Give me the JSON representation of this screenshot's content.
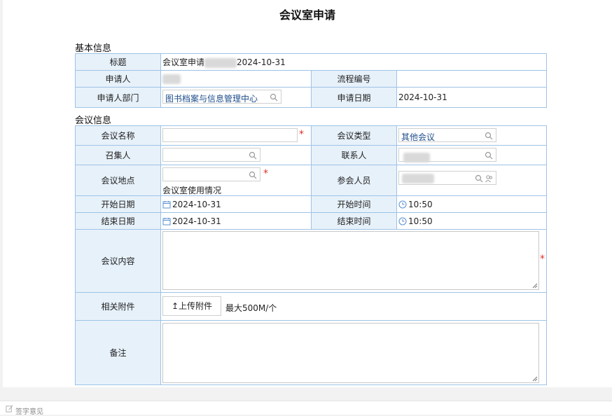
{
  "page_title": "会议室申请",
  "sections": {
    "basic": "基本信息",
    "meeting": "会议信息"
  },
  "basic": {
    "subject_label": "标题",
    "subject_prefix": "会议室申请",
    "subject_date": "2024-10-31",
    "applicant_label": "申请人",
    "flow_no_label": "流程编号",
    "flow_no_value": "",
    "department_label": "申请人部门",
    "department_value": "图书档案与信息管理中心",
    "apply_date_label": "申请日期",
    "apply_date_value": "2024-10-31"
  },
  "meeting": {
    "name_label": "会议名称",
    "name_value": "",
    "type_label": "会议类型",
    "type_value": "其他会议",
    "convener_label": "召集人",
    "convener_value": "",
    "contact_label": "联系人",
    "location_label": "会议地点",
    "location_value": "",
    "room_usage_link": "会议室使用情况",
    "attendees_label": "参会人员",
    "start_date_label": "开始日期",
    "start_date_value": "2024-10-31",
    "start_time_label": "开始时间",
    "start_time_value": "10:50",
    "end_date_label": "结束日期",
    "end_date_value": "2024-10-31",
    "end_time_label": "结束时间",
    "end_time_value": "10:50",
    "content_label": "会议内容",
    "content_value": "",
    "attachment_label": "相关附件",
    "upload_label": "↥上传附件",
    "upload_limit": "最大500M/个",
    "remark_label": "备注",
    "remark_value": ""
  },
  "required_mark": "*",
  "footer": {
    "signature_label": "签字意见"
  },
  "colors": {
    "border": "#9ec3e6",
    "label_bg": "#e7f1fa",
    "required": "#e0302a",
    "link": "#1f4e8c"
  }
}
